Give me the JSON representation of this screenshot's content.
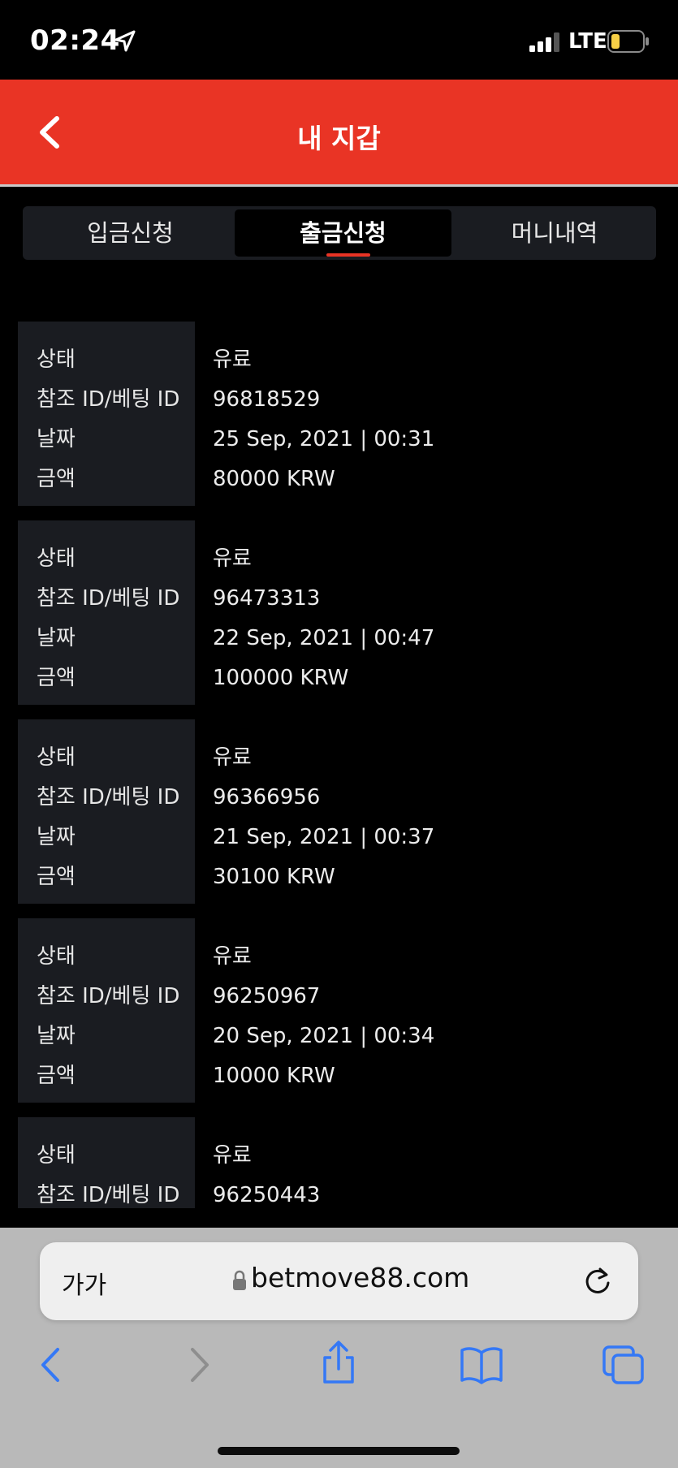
{
  "status_bar": {
    "time": "02:24",
    "network": "LTE",
    "icons": [
      "location-arrow-icon",
      "signal-icon",
      "battery-icon"
    ]
  },
  "header": {
    "title": "내 지갑",
    "back_icon": "chevron-left-icon"
  },
  "tabs": [
    {
      "label": "입금신청",
      "active": false
    },
    {
      "label": "출금신청",
      "active": true
    },
    {
      "label": "머니내역",
      "active": false
    }
  ],
  "labels": {
    "status": "상태",
    "ref_id": "참조 ID/베팅 ID",
    "date": "날짜",
    "amount": "금액"
  },
  "transactions": [
    {
      "status": "유료",
      "ref_id": "96818529",
      "date": "25 Sep, 2021 | 00:31",
      "amount": "80000 KRW"
    },
    {
      "status": "유료",
      "ref_id": "96473313",
      "date": "22 Sep, 2021 | 00:47",
      "amount": "100000 KRW"
    },
    {
      "status": "유료",
      "ref_id": "96366956",
      "date": "21 Sep, 2021 | 00:37",
      "amount": "30100 KRW"
    },
    {
      "status": "유료",
      "ref_id": "96250967",
      "date": "20 Sep, 2021 | 00:34",
      "amount": "10000 KRW"
    },
    {
      "status": "유료",
      "ref_id": "96250443"
    }
  ],
  "browser": {
    "text_size_label": "가가",
    "url": "betmove88.com",
    "toolbar_icons": [
      "back-arrow-icon",
      "forward-arrow-icon",
      "share-icon",
      "bookmarks-icon",
      "tabs-icon"
    ]
  },
  "colors": {
    "accent": "#e93425",
    "card_bg": "#1a1c21",
    "browser_blue": "#3478f6"
  }
}
